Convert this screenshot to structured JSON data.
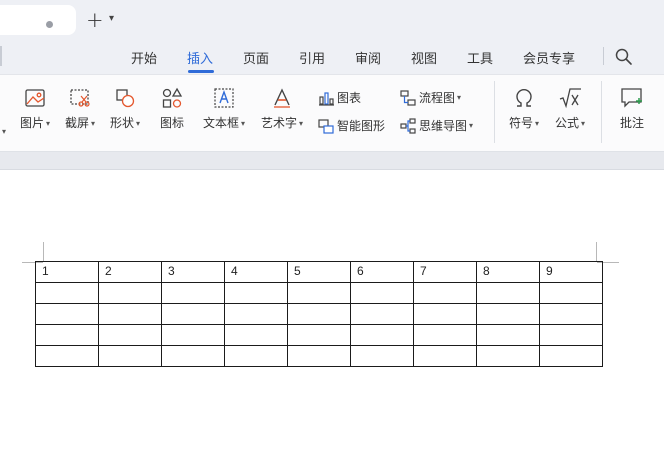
{
  "tabs": {
    "new_tab_symbol": "+",
    "caret": "⌄"
  },
  "menu": {
    "items": [
      "开始",
      "插入",
      "页面",
      "引用",
      "审阅",
      "视图",
      "工具",
      "会员专享"
    ],
    "active_index": 1,
    "accent_color": "#2f6bd8"
  },
  "ribbon": {
    "picture": "图片",
    "screenshot": "截屏",
    "shape": "形状",
    "icon": "图标",
    "textbox": "文本框",
    "wordart": "艺术字",
    "chart": "图表",
    "smart_graphic": "智能图形",
    "flowchart": "流程图",
    "mindmap": "思维导图",
    "symbol": "符号",
    "formula": "公式",
    "comment": "批注"
  },
  "document": {
    "table": {
      "header": [
        "1",
        "2",
        "3",
        "4",
        "5",
        "6",
        "7",
        "8",
        "9"
      ],
      "rows": [
        [
          "",
          "",
          "",
          "",
          "",
          "",
          "",
          "",
          ""
        ],
        [
          "",
          "",
          "",
          "",
          "",
          "",
          "",
          "",
          ""
        ],
        [
          "",
          "",
          "",
          "",
          "",
          "",
          "",
          "",
          ""
        ],
        [
          "",
          "",
          "",
          "",
          "",
          "",
          "",
          "",
          ""
        ]
      ]
    }
  }
}
